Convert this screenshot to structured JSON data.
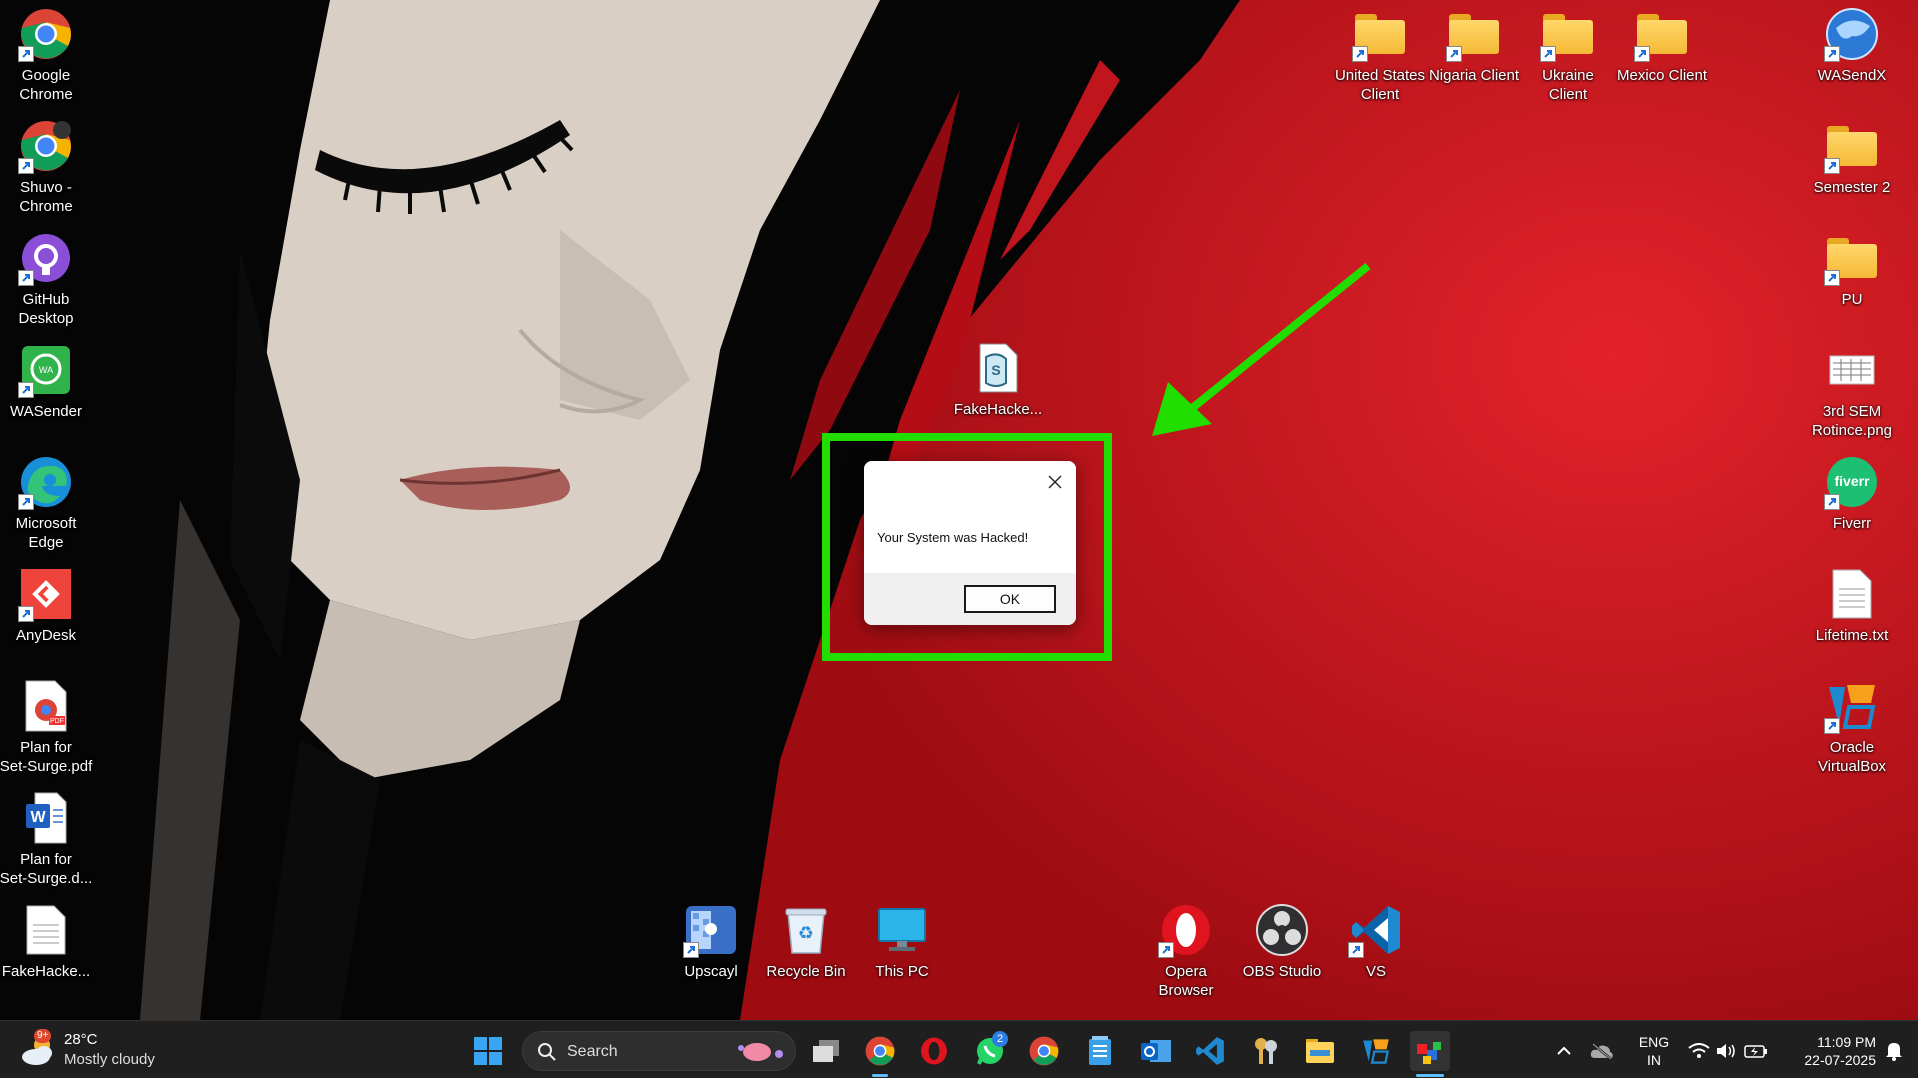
{
  "desktop": {
    "left_icons": [
      {
        "label": "Google\nChrome",
        "icon": "chrome-icon"
      },
      {
        "label": "Shuvo -\nChrome",
        "icon": "chrome-profile-icon"
      },
      {
        "label": "GitHub\nDesktop",
        "icon": "github-desktop-icon"
      },
      {
        "label": "WASender",
        "icon": "wasender-icon"
      },
      {
        "label": "Microsoft\nEdge",
        "icon": "edge-icon"
      },
      {
        "label": "AnyDesk",
        "icon": "anydesk-icon"
      },
      {
        "label": "Plan for\nSet-Surge.pdf",
        "icon": "pdf-icon"
      },
      {
        "label": "Plan for\nSet-Surge.d...",
        "icon": "word-icon"
      },
      {
        "label": "FakeHacke...",
        "icon": "text-file-icon"
      }
    ],
    "top_folders": [
      {
        "label": "United States\nClient"
      },
      {
        "label": "Nigaria Client"
      },
      {
        "label": "Ukraine\nClient"
      },
      {
        "label": "Mexico Client"
      }
    ],
    "right_icons": [
      {
        "label": "WASendX",
        "icon": "wasendx-icon"
      },
      {
        "label": "Semester 2",
        "icon": "folder-icon"
      },
      {
        "label": "PU",
        "icon": "folder-icon"
      },
      {
        "label": "3rd SEM\nRotince.png",
        "icon": "image-file-icon"
      },
      {
        "label": "Fiverr",
        "icon": "fiverr-icon"
      },
      {
        "label": "Lifetime.txt",
        "icon": "text-file-icon"
      },
      {
        "label": "Oracle\nVirtualBox",
        "icon": "virtualbox-icon"
      }
    ],
    "center_icon": {
      "label": "FakeHacke...",
      "icon": "script-file-icon"
    },
    "bottom_icons": [
      {
        "label": "Upscayl",
        "icon": "upscayl-icon"
      },
      {
        "label": "Recycle Bin",
        "icon": "recycle-bin-icon"
      },
      {
        "label": "This PC",
        "icon": "this-pc-icon"
      },
      {
        "label": "Opera\nBrowser",
        "icon": "opera-icon"
      },
      {
        "label": "OBS Studio",
        "icon": "obs-icon"
      },
      {
        "label": "VS",
        "icon": "vscode-icon"
      }
    ],
    "fiverr_text": "fiverr"
  },
  "dialog": {
    "message": "Your System was Hacked!",
    "ok_label": "OK"
  },
  "annotation": {
    "highlight_color": "#22dd00",
    "arrow_color": "#22dd00"
  },
  "taskbar": {
    "weather_temp": "28°C",
    "weather_condition": "Mostly cloudy",
    "weather_badge": "9+",
    "search_placeholder": "Search",
    "whatsapp_badge": "2",
    "language_top": "ENG",
    "language_bottom": "IN",
    "time": "11:09 PM",
    "date": "22-07-2025"
  }
}
